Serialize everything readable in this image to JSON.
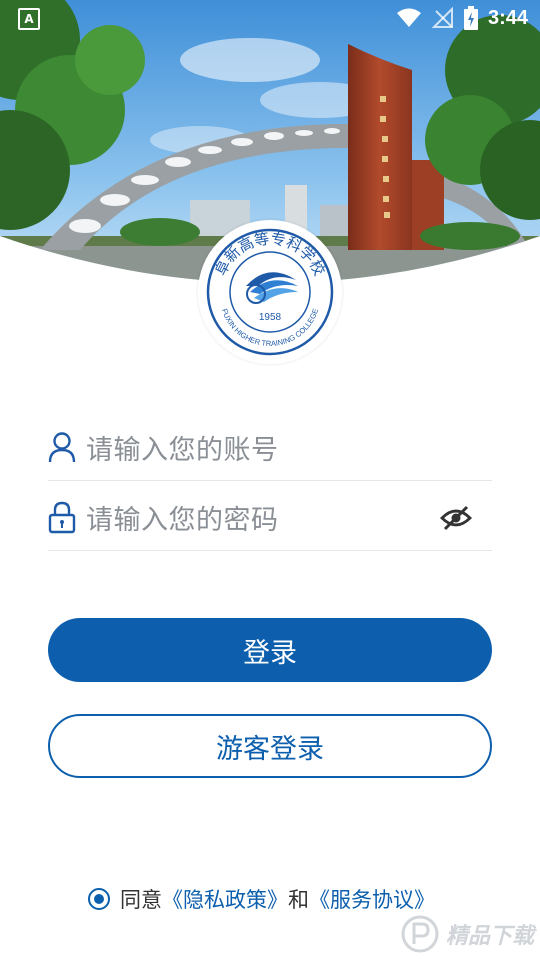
{
  "status_bar": {
    "time": "3:44",
    "left_icon_text": "A"
  },
  "logo": {
    "text_top": "阜新高等专科学校",
    "year": "1958",
    "text_bottom": "FUXIN HIGHER TRAINING COLLEGE"
  },
  "form": {
    "account_placeholder": "请输入您的账号",
    "password_placeholder": "请输入您的密码"
  },
  "buttons": {
    "login_label": "登录",
    "guest_login_label": "游客登录"
  },
  "agreement": {
    "prefix": "同意",
    "privacy_link": "《隐私政策》",
    "conjunction": "和",
    "service_link": "《服务协议》"
  },
  "watermark": {
    "text": "精品下载"
  },
  "colors": {
    "primary": "#0d5fae",
    "placeholder": "#8a8f96"
  }
}
